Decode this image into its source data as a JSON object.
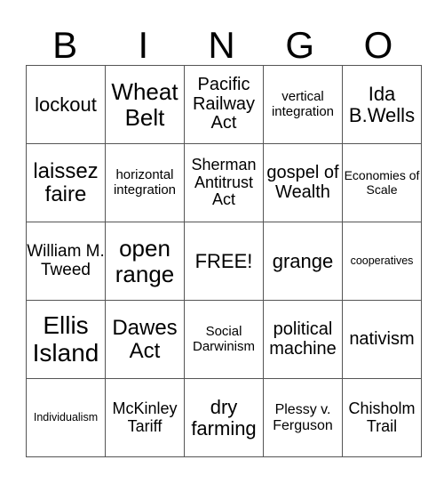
{
  "header": {
    "letters": [
      "B",
      "I",
      "N",
      "G",
      "O"
    ]
  },
  "board": {
    "rows": [
      [
        "lockout",
        "Wheat Belt",
        "Pacific Railway Act",
        "vertical integration",
        "Ida B.Wells"
      ],
      [
        "laissez faire",
        "horizontal integration",
        "Sherman Antitrust Act",
        "gospel of Wealth",
        "Economies of Scale"
      ],
      [
        "William M. Tweed",
        "open range",
        "FREE!",
        "grange",
        "cooperatives"
      ],
      [
        "Ellis Island",
        "Dawes Act",
        "Social Darwinism",
        "political machine",
        "nativism"
      ],
      [
        "Individualism",
        "McKinley Tariff",
        "dry farming",
        "Plessy v. Ferguson",
        "Chisholm Trail"
      ]
    ]
  }
}
